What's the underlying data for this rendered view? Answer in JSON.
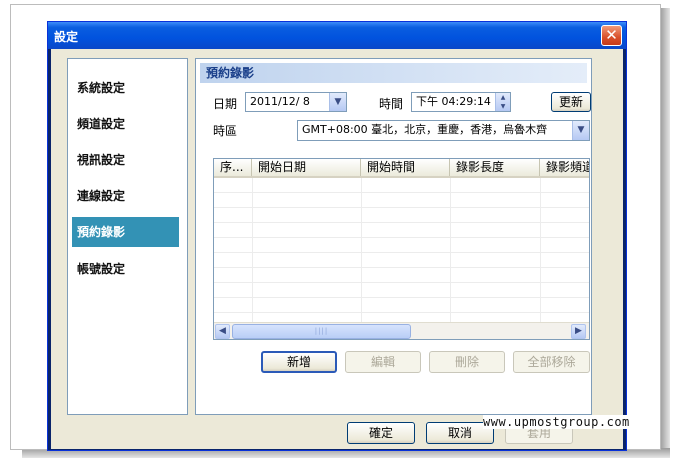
{
  "window": {
    "title": "設定"
  },
  "sidebar": {
    "items": [
      {
        "label": "系統設定"
      },
      {
        "label": "頻道設定"
      },
      {
        "label": "視訊設定"
      },
      {
        "label": "連線設定"
      },
      {
        "label": "預約錄影",
        "active": true
      },
      {
        "label": "帳號設定"
      }
    ]
  },
  "section": {
    "title": "預約錄影"
  },
  "form": {
    "date_label": "日期",
    "date_value": "2011/12/ 8",
    "time_label": "時間",
    "time_value": "下午 04:29:14",
    "update_label": "更新",
    "timezone_label": "時區",
    "timezone_value": "GMT+08:00 臺北，北京，重慶，香港，烏魯木齊"
  },
  "table": {
    "columns": [
      "序...",
      "開始日期",
      "開始時間",
      "錄影長度",
      "錄影頻道"
    ]
  },
  "actions": {
    "add_label": "新增",
    "edit_label": "編輯",
    "delete_label": "刪除",
    "remove_all_label": "全部移除"
  },
  "footer": {
    "ok_label": "確定",
    "cancel_label": "取消",
    "apply_label": "套用"
  },
  "watermark": "www.upmostgroup.com",
  "colors": {
    "active": "#3392b5",
    "titlebar": "#0152de",
    "dialog_bg": "#ece9d8"
  },
  "icons": [
    "close-icon",
    "chevron-down-icon",
    "spin-up-icon",
    "spin-down-icon",
    "scroll-left-icon",
    "scroll-right-icon"
  ]
}
